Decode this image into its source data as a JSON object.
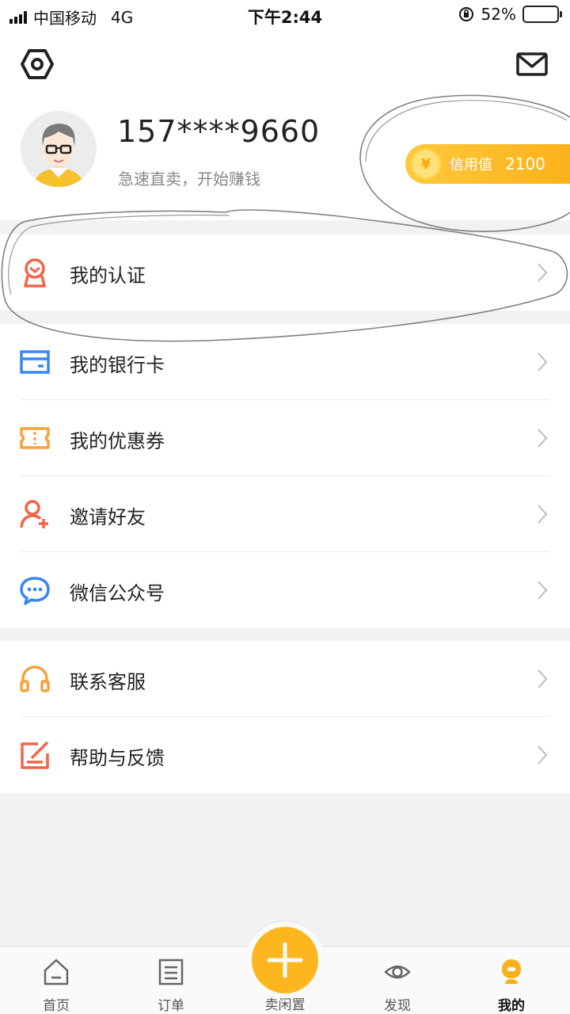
{
  "status_bar": {
    "carrier": "中国移动",
    "network": "4G",
    "time": "下午2:44",
    "battery_percent": "52%",
    "battery_level": 0.52
  },
  "profile": {
    "phone": "157****9660",
    "slogan": "急速直卖，开始赚钱",
    "credit_label": "信用值",
    "credit_value": "2100",
    "coin_symbol": "¥"
  },
  "menu": {
    "certification": {
      "label": "我的认证",
      "icon": "certificate-badge-icon"
    },
    "bank_card": {
      "label": "我的银行卡",
      "icon": "bank-card-icon"
    },
    "coupons": {
      "label": "我的优惠券",
      "icon": "ticket-icon"
    },
    "invite": {
      "label": "邀请好友",
      "icon": "add-user-icon"
    },
    "wechat": {
      "label": "微信公众号",
      "icon": "chat-bubble-icon"
    },
    "support": {
      "label": "联系客服",
      "icon": "headset-icon"
    },
    "feedback": {
      "label": "帮助与反馈",
      "icon": "edit-icon"
    }
  },
  "tabbar": {
    "home": "首页",
    "orders": "订单",
    "publish": "卖闲置",
    "discover": "发现",
    "mine": "我的"
  },
  "colors": {
    "accent": "#fdb61d",
    "red_icon": "#f2654a",
    "blue_icon": "#3a86f0",
    "orange_icon": "#f7a23a"
  }
}
